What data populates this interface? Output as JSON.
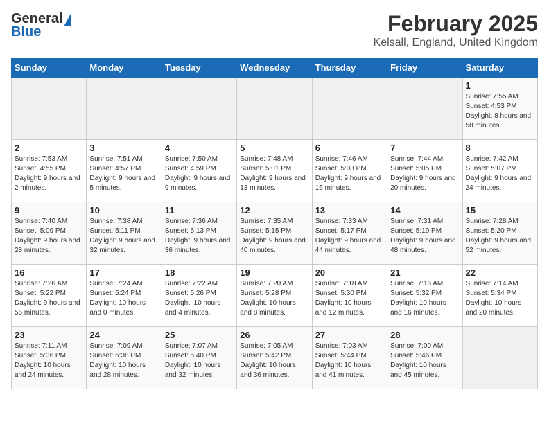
{
  "header": {
    "logo_general": "General",
    "logo_blue": "Blue",
    "title": "February 2025",
    "subtitle": "Kelsall, England, United Kingdom"
  },
  "days_of_week": [
    "Sunday",
    "Monday",
    "Tuesday",
    "Wednesday",
    "Thursday",
    "Friday",
    "Saturday"
  ],
  "weeks": [
    [
      {
        "day": "",
        "info": ""
      },
      {
        "day": "",
        "info": ""
      },
      {
        "day": "",
        "info": ""
      },
      {
        "day": "",
        "info": ""
      },
      {
        "day": "",
        "info": ""
      },
      {
        "day": "",
        "info": ""
      },
      {
        "day": "1",
        "info": "Sunrise: 7:55 AM\nSunset: 4:53 PM\nDaylight: 8 hours and 58 minutes."
      }
    ],
    [
      {
        "day": "2",
        "info": "Sunrise: 7:53 AM\nSunset: 4:55 PM\nDaylight: 9 hours and 2 minutes."
      },
      {
        "day": "3",
        "info": "Sunrise: 7:51 AM\nSunset: 4:57 PM\nDaylight: 9 hours and 5 minutes."
      },
      {
        "day": "4",
        "info": "Sunrise: 7:50 AM\nSunset: 4:59 PM\nDaylight: 9 hours and 9 minutes."
      },
      {
        "day": "5",
        "info": "Sunrise: 7:48 AM\nSunset: 5:01 PM\nDaylight: 9 hours and 13 minutes."
      },
      {
        "day": "6",
        "info": "Sunrise: 7:46 AM\nSunset: 5:03 PM\nDaylight: 9 hours and 16 minutes."
      },
      {
        "day": "7",
        "info": "Sunrise: 7:44 AM\nSunset: 5:05 PM\nDaylight: 9 hours and 20 minutes."
      },
      {
        "day": "8",
        "info": "Sunrise: 7:42 AM\nSunset: 5:07 PM\nDaylight: 9 hours and 24 minutes."
      }
    ],
    [
      {
        "day": "9",
        "info": "Sunrise: 7:40 AM\nSunset: 5:09 PM\nDaylight: 9 hours and 28 minutes."
      },
      {
        "day": "10",
        "info": "Sunrise: 7:38 AM\nSunset: 5:11 PM\nDaylight: 9 hours and 32 minutes."
      },
      {
        "day": "11",
        "info": "Sunrise: 7:36 AM\nSunset: 5:13 PM\nDaylight: 9 hours and 36 minutes."
      },
      {
        "day": "12",
        "info": "Sunrise: 7:35 AM\nSunset: 5:15 PM\nDaylight: 9 hours and 40 minutes."
      },
      {
        "day": "13",
        "info": "Sunrise: 7:33 AM\nSunset: 5:17 PM\nDaylight: 9 hours and 44 minutes."
      },
      {
        "day": "14",
        "info": "Sunrise: 7:31 AM\nSunset: 5:19 PM\nDaylight: 9 hours and 48 minutes."
      },
      {
        "day": "15",
        "info": "Sunrise: 7:28 AM\nSunset: 5:20 PM\nDaylight: 9 hours and 52 minutes."
      }
    ],
    [
      {
        "day": "16",
        "info": "Sunrise: 7:26 AM\nSunset: 5:22 PM\nDaylight: 9 hours and 56 minutes."
      },
      {
        "day": "17",
        "info": "Sunrise: 7:24 AM\nSunset: 5:24 PM\nDaylight: 10 hours and 0 minutes."
      },
      {
        "day": "18",
        "info": "Sunrise: 7:22 AM\nSunset: 5:26 PM\nDaylight: 10 hours and 4 minutes."
      },
      {
        "day": "19",
        "info": "Sunrise: 7:20 AM\nSunset: 5:28 PM\nDaylight: 10 hours and 8 minutes."
      },
      {
        "day": "20",
        "info": "Sunrise: 7:18 AM\nSunset: 5:30 PM\nDaylight: 10 hours and 12 minutes."
      },
      {
        "day": "21",
        "info": "Sunrise: 7:16 AM\nSunset: 5:32 PM\nDaylight: 10 hours and 16 minutes."
      },
      {
        "day": "22",
        "info": "Sunrise: 7:14 AM\nSunset: 5:34 PM\nDaylight: 10 hours and 20 minutes."
      }
    ],
    [
      {
        "day": "23",
        "info": "Sunrise: 7:11 AM\nSunset: 5:36 PM\nDaylight: 10 hours and 24 minutes."
      },
      {
        "day": "24",
        "info": "Sunrise: 7:09 AM\nSunset: 5:38 PM\nDaylight: 10 hours and 28 minutes."
      },
      {
        "day": "25",
        "info": "Sunrise: 7:07 AM\nSunset: 5:40 PM\nDaylight: 10 hours and 32 minutes."
      },
      {
        "day": "26",
        "info": "Sunrise: 7:05 AM\nSunset: 5:42 PM\nDaylight: 10 hours and 36 minutes."
      },
      {
        "day": "27",
        "info": "Sunrise: 7:03 AM\nSunset: 5:44 PM\nDaylight: 10 hours and 41 minutes."
      },
      {
        "day": "28",
        "info": "Sunrise: 7:00 AM\nSunset: 5:46 PM\nDaylight: 10 hours and 45 minutes."
      },
      {
        "day": "",
        "info": ""
      }
    ]
  ]
}
